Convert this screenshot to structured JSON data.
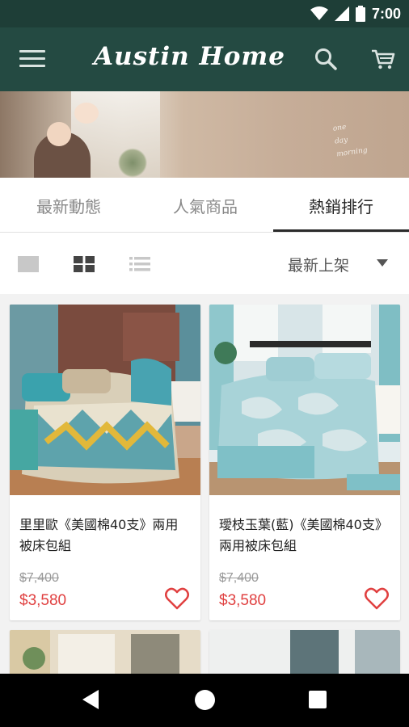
{
  "status_bar": {
    "time": "7:00"
  },
  "app_bar": {
    "brand": "Austin Home",
    "menu_icon": "hamburger-menu-icon",
    "search_icon": "search-icon",
    "cart_icon": "shopping-cart-icon"
  },
  "banner": {
    "script_text": "one\nday\nmorning"
  },
  "tabs": [
    {
      "label": "最新動態",
      "active": false
    },
    {
      "label": "人氣商品",
      "active": false
    },
    {
      "label": "熱銷排行",
      "active": true
    }
  ],
  "toolbar": {
    "views": [
      "single-view-icon",
      "grid-view-icon",
      "list-view-icon"
    ],
    "active_view": "grid-view-icon",
    "sort_label": "最新上架"
  },
  "products": [
    {
      "name": "里里歐《美國棉40支》兩用被床包組",
      "old_price": "$7,400",
      "price": "$3,580"
    },
    {
      "name": "璦枝玉葉(藍)《美國棉40支》兩用被床包組",
      "old_price": "$7,400",
      "price": "$3,580"
    }
  ],
  "colors": {
    "app_bar": "#244a42",
    "status_bar": "#1e3e37",
    "price": "#e04040"
  }
}
